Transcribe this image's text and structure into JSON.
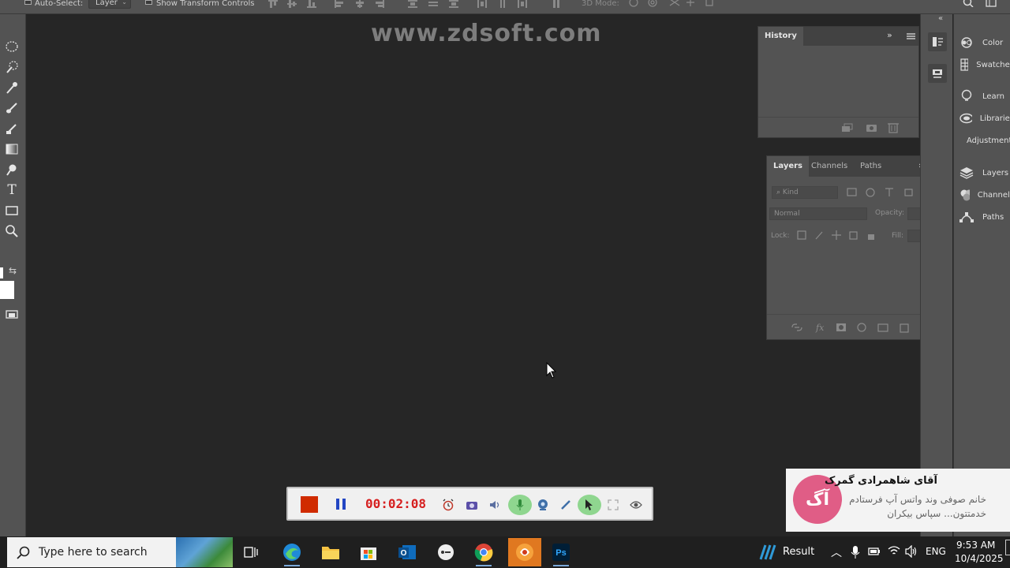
{
  "options_bar": {
    "auto_select_label": "Auto-Select:",
    "auto_select_target": "Layer",
    "show_transform_label": "Show Transform Controls",
    "mode_3d_label": "3D Mode:"
  },
  "watermark": "www.zdsoft.com",
  "history_panel": {
    "tab": "History"
  },
  "layers_panel": {
    "tabs": [
      "Layers",
      "Channels",
      "Paths"
    ],
    "search_placeholder": "Kind",
    "blend_mode": "Normal",
    "opacity_label": "Opacity:",
    "lock_label": "Lock:",
    "fill_label": "Fill:"
  },
  "right_dock": {
    "items": [
      "Color",
      "Swatches",
      "Learn",
      "Libraries",
      "Adjustments",
      "Layers",
      "Channels",
      "Paths"
    ]
  },
  "recorder": {
    "time": "00:02:08"
  },
  "notification": {
    "avatar": "آگ",
    "title": "آقای شاهمرادی گمرک",
    "body": "خانم صوفی وند واتس آپ فرستادم خدمتتون... سپاس بیکران"
  },
  "taskbar": {
    "search_placeholder": "Type here to search",
    "weather_label": "Result",
    "language": "ENG",
    "time": "9:53 AM",
    "date": "10/4/2025"
  },
  "colors": {
    "ps_panel": "#535353",
    "ps_canvas": "#262626",
    "recorder_stop": "#d02b00",
    "recorder_time": "#d62020",
    "notif_avatar": "#e05d86"
  }
}
